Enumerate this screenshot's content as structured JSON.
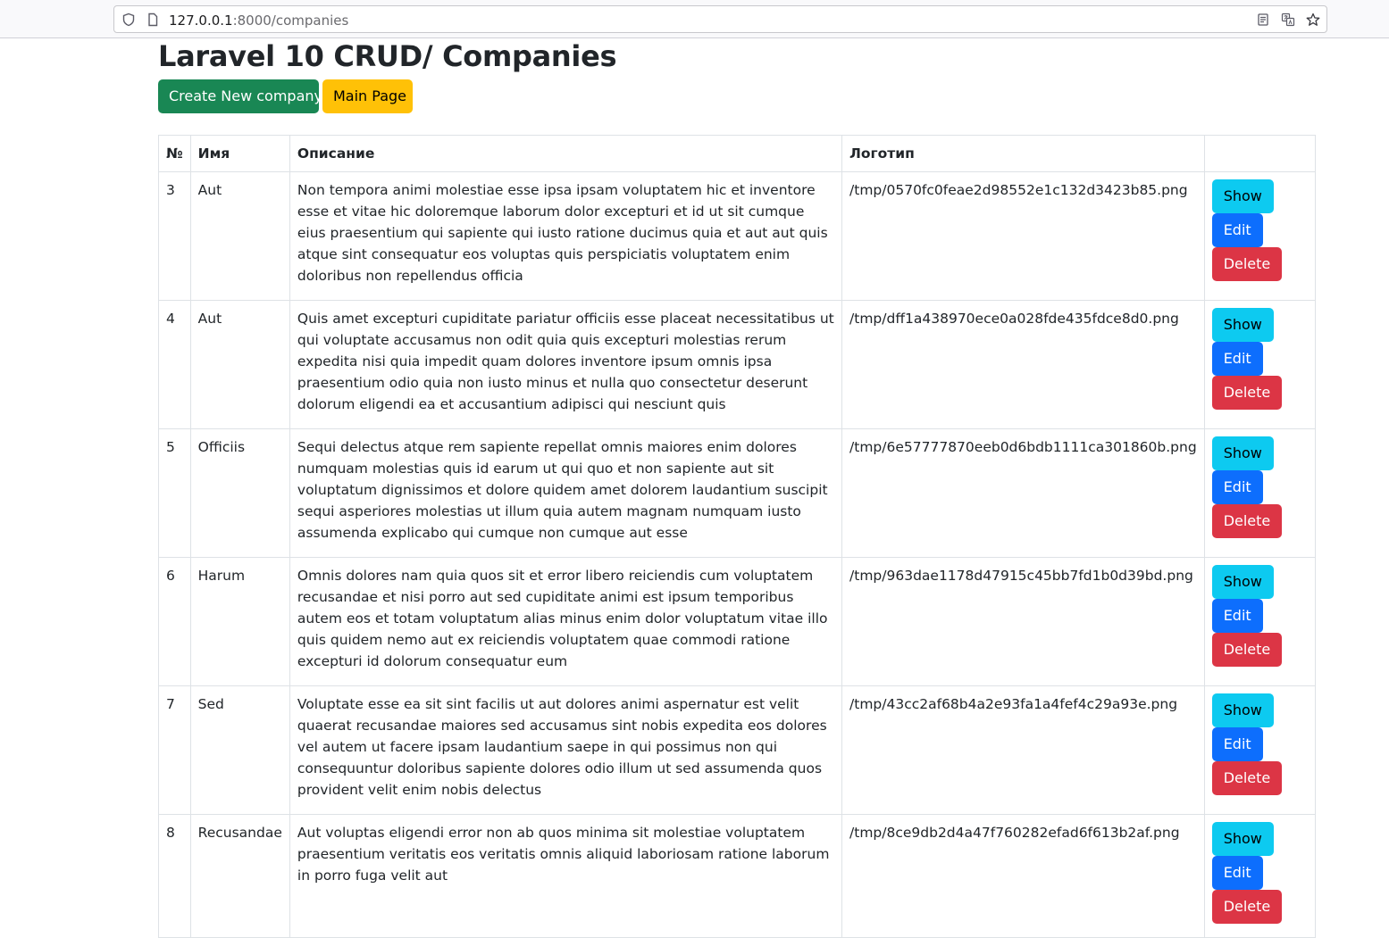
{
  "browser": {
    "url_host": "127.0.0.1",
    "url_path": ":8000/companies"
  },
  "page": {
    "title": "Laravel 10 CRUD/ Companies",
    "create_label": "Create New company",
    "main_label": "Main Page"
  },
  "table": {
    "headers": [
      "№",
      "Имя",
      "Описание",
      "Логотип",
      ""
    ],
    "actions": {
      "show": "Show",
      "edit": "Edit",
      "delete": "Delete"
    },
    "rows": [
      {
        "id": "3",
        "name": "Aut",
        "description": "Non tempora animi molestiae esse ipsa ipsam voluptatem hic et inventore esse et vitae hic doloremque laborum dolor excepturi et id ut sit cumque eius praesentium qui sapiente qui iusto ratione ducimus quia et aut aut quis atque sint consequatur eos voluptas quis perspiciatis voluptatem enim doloribus non repellendus officia",
        "logo": "/tmp/0570fc0feae2d98552e1c132d3423b85.png"
      },
      {
        "id": "4",
        "name": "Aut",
        "description": "Quis amet excepturi cupiditate pariatur officiis esse placeat necessitatibus ut qui voluptate accusamus non odit quia quis excepturi molestias rerum expedita nisi quia impedit quam dolores inventore ipsum omnis ipsa praesentium odio quia non iusto minus et nulla quo consectetur deserunt dolorum eligendi ea et accusantium adipisci qui nesciunt quis",
        "logo": "/tmp/dff1a438970ece0a028fde435fdce8d0.png"
      },
      {
        "id": "5",
        "name": "Officiis",
        "description": "Sequi delectus atque rem sapiente repellat omnis maiores enim dolores numquam molestias quis id earum ut qui quo et non sapiente aut sit voluptatum dignissimos et dolore quidem amet dolorem laudantium suscipit sequi asperiores molestias ut illum quia autem magnam numquam iusto assumenda explicabo qui cumque non cumque aut esse",
        "logo": "/tmp/6e57777870eeb0d6bdb1111ca301860b.png"
      },
      {
        "id": "6",
        "name": "Harum",
        "description": "Omnis dolores nam quia quos sit et error libero reiciendis cum voluptatem recusandae et nisi porro aut sed cupiditate animi est ipsum temporibus autem eos et totam voluptatum alias minus enim dolor voluptatum vitae illo quis quidem nemo aut ex reiciendis voluptatem quae commodi ratione excepturi id dolorum consequatur eum",
        "logo": "/tmp/963dae1178d47915c45bb7fd1b0d39bd.png"
      },
      {
        "id": "7",
        "name": "Sed",
        "description": "Voluptate esse ea sit sint facilis ut aut dolores animi aspernatur est velit quaerat recusandae maiores sed accusamus sint nobis expedita eos dolores vel autem ut facere ipsam laudantium saepe in qui possimus non qui consequuntur doloribus sapiente dolores odio illum ut sed assumenda quos provident velit enim nobis delectus",
        "logo": "/tmp/43cc2af68b4a2e93fa1a4fef4c29a93e.png"
      },
      {
        "id": "8",
        "name": "Recusandae",
        "description": "Aut voluptas eligendi error non ab quos minima sit molestiae voluptatem praesentium veritatis eos veritatis omnis aliquid laboriosam ratione laborum in porro fuga velit aut",
        "logo": "/tmp/8ce9db2d4a47f760282efad6f613b2af.png"
      }
    ]
  }
}
